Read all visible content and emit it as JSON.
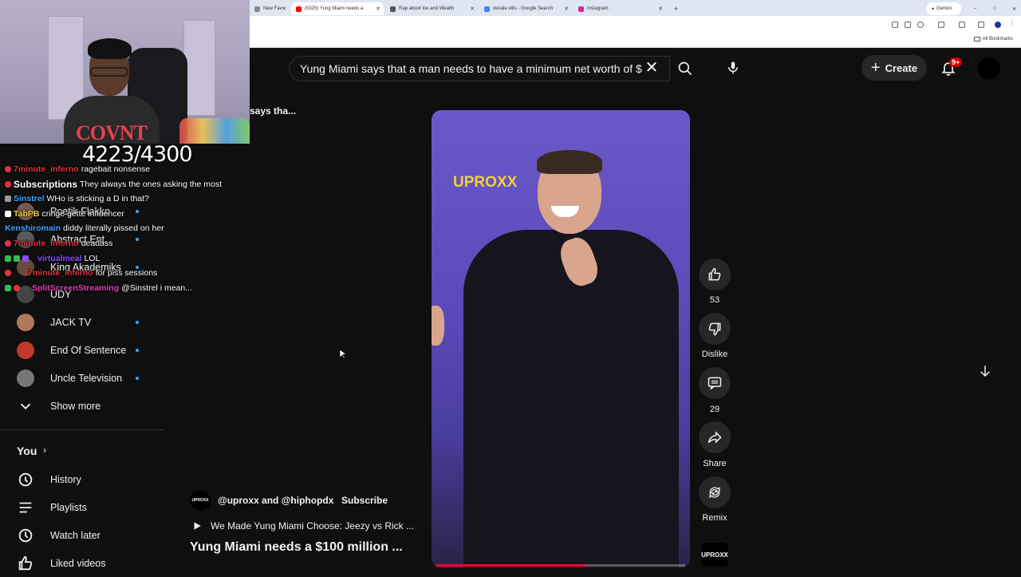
{
  "browser": {
    "tabs": [
      {
        "label": "New Fav",
        "active": false,
        "color": "#888888"
      },
      {
        "label": "(5325) Yung Miami needs a",
        "active": true,
        "color": "#ff0000"
      },
      {
        "label": "Rap about Ice and Wealth",
        "active": false,
        "color": "#555555"
      },
      {
        "label": "devale ellis - Google Search",
        "active": false,
        "color": "#4285f4"
      },
      {
        "label": "Instagram",
        "active": false,
        "color": "#d6249f"
      }
    ],
    "gemini_label": "Gemini",
    "bookmarks_label": "All Bookmarks"
  },
  "stream": {
    "sub_counter": "4223/4300",
    "chat": [
      {
        "name": "7minute_inferno",
        "name_color": "#e0323e",
        "text": "ragebait nonsense",
        "badges": [
          "#e0323e"
        ]
      },
      {
        "name": "Subscriptions",
        "name_color": "#ffffff",
        "text": "They always the ones asking the most",
        "badges": [
          "#e0323e"
        ]
      },
      {
        "name": "Sinstrel",
        "name_color": "#3ea6ff",
        "text": "WHo is sticking a D in that?",
        "badges": [
          "#999999"
        ]
      },
      {
        "name": "TabPB",
        "name_color": "#f0d23a",
        "text": "cringe gette influencer",
        "badges": [
          "#ffffff"
        ]
      },
      {
        "name": "Kenshiromain",
        "name_color": "#3ea6ff",
        "text": "diddy literally pissed on her",
        "badges": []
      },
      {
        "name": "7minute_inferno",
        "name_color": "#e0323e",
        "text": "deadass",
        "badges": [
          "#e0323e"
        ]
      },
      {
        "name": "virtualmeal",
        "name_color": "#8a4dff",
        "text": "LOL",
        "badges": [
          "#2fbf4a",
          "#2fbf4a",
          "#8a4dff"
        ]
      },
      {
        "name": "7minute_inferno",
        "name_color": "#e0323e",
        "text": "for piss sessions",
        "badges": [
          "#e0323e"
        ]
      },
      {
        "name": "SplitScreenStreaming",
        "name_color": "#e040b0",
        "text": "@Sinstrel i mean...",
        "badges": [
          "#2fbf4a",
          "#e0323e"
        ]
      }
    ]
  },
  "header": {
    "search_value": "Yung Miami says that a man needs to have a minimum net worth of $",
    "create_label": "Create",
    "notif_count": "9+"
  },
  "sidebar": {
    "subscriptions": [
      {
        "label": "Poetik Flakko",
        "color": "#7a5a4a"
      },
      {
        "label": "Abstract Ent.",
        "color": "#5a5a5a"
      },
      {
        "label": "King Akademiks",
        "color": "#6a4a3a"
      },
      {
        "label": "UDY",
        "color": "#444444"
      },
      {
        "label": "JACK TV",
        "color": "#b07a5a"
      },
      {
        "label": "End Of Sentence",
        "color": "#c0392b"
      },
      {
        "label": "Uncle Television",
        "color": "#777777"
      }
    ],
    "show_more": "Show more",
    "you_title": "You",
    "you_items": [
      {
        "label": "History",
        "icon": "history-icon"
      },
      {
        "label": "Playlists",
        "icon": "playlists-icon"
      },
      {
        "label": "Watch later",
        "icon": "watch-later-icon"
      },
      {
        "label": "Liked videos",
        "icon": "liked-videos-icon"
      }
    ]
  },
  "player": {
    "partial_text": "says tha...",
    "logo_text": "UPROXX",
    "progress": 0.6,
    "likes": "53",
    "dislike_label": "Dislike",
    "comments": "29",
    "share_label": "Share",
    "remix_label": "Remix",
    "channel_mini": "UPROXX"
  },
  "channel": {
    "avatar_text": "UPROXX",
    "name": "@uproxx and @hiphopdx",
    "subscribe_label": "Subscribe",
    "related_title": "We Made Yung Miami Choose: Jeezy vs Rick ...",
    "video_title": "Yung Miami needs a $100 million ..."
  }
}
